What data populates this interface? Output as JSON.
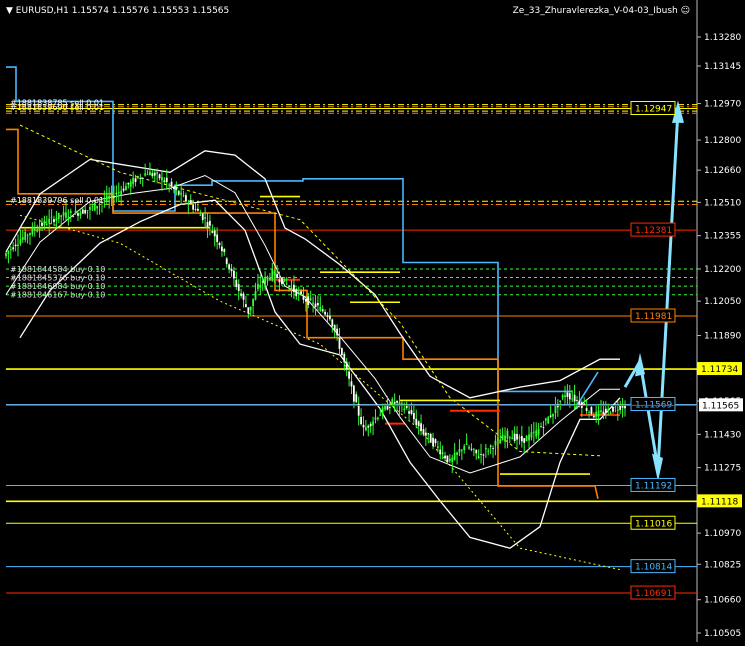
{
  "header": {
    "symbol_label": "EURUSD,H1",
    "ohlc": "1.15574 1.15576 1.15553 1.15565",
    "expert_name": "Ze_33_Zhuravlerezka_V-04-03_Ibush",
    "smiley": "☺"
  },
  "colors": {
    "background": "#000000",
    "axis_text": "#ffffff",
    "bull_candle": "#33ff33",
    "bear_candle": "#ffffff",
    "yellow": "#ffff00",
    "orange": "#ff8000",
    "red": "#ff2a00",
    "cyan": "#49b8ff",
    "light_cyan": "#7fdfff",
    "white_band": "#ffffff",
    "sky_arrow": "#87e3ff"
  },
  "chart_data": {
    "type": "candlestick",
    "ylim": [
      1.10505,
      1.13345
    ],
    "y_ticks": [
      "1.13280",
      "1.13145",
      "1.12970",
      "1.12800",
      "1.12660",
      "1.12510",
      "1.12355",
      "1.12200",
      "1.12050",
      "1.11890",
      "1.11740",
      "1.11585",
      "1.11430",
      "1.11275",
      "1.11120",
      "1.10970",
      "1.10825",
      "1.10660",
      "1.10505"
    ],
    "current_price": "1.11565",
    "price_levels": [
      {
        "price": "1.12947",
        "color": "yellow",
        "style": "solid-box"
      },
      {
        "price": "1.12381",
        "color": "red",
        "style": "line"
      },
      {
        "price": "1.11981",
        "color": "orange",
        "style": "line"
      },
      {
        "price": "1.11734",
        "color": "yellow",
        "style": "filled"
      },
      {
        "price": "1.11569",
        "color": "cyan",
        "style": "line"
      },
      {
        "price": "1.11192",
        "color": "cyan",
        "style": "line"
      },
      {
        "price": "1.11118",
        "color": "yellow",
        "style": "filled"
      },
      {
        "price": "1.11016",
        "color": "yellow",
        "style": "line"
      },
      {
        "price": "1.10814",
        "color": "cyan",
        "style": "line"
      },
      {
        "price": "1.10691",
        "color": "red",
        "style": "line"
      }
    ],
    "order_labels": [
      "#1881838785 sell 0.01",
      "#1881839690 sell 0.01",
      "#1881839796 sell 0.01",
      "#1881844584 buy 0.10",
      "#1881845376 buy 0.10",
      "#1881846084 buy 0.10",
      "#1881846167 buy 0.10"
    ],
    "close_path": [
      [
        0,
        1.1226
      ],
      [
        6,
        1.1233
      ],
      [
        12,
        1.1238
      ],
      [
        18,
        1.1242
      ],
      [
        24,
        1.1245
      ],
      [
        30,
        1.1246
      ],
      [
        36,
        1.1248
      ],
      [
        42,
        1.1252
      ],
      [
        48,
        1.1256
      ],
      [
        54,
        1.1261
      ],
      [
        60,
        1.1265
      ],
      [
        66,
        1.1262
      ],
      [
        72,
        1.1256
      ],
      [
        78,
        1.125
      ],
      [
        84,
        1.1243
      ],
      [
        90,
        1.1232
      ],
      [
        96,
        1.1215
      ],
      [
        102,
        1.12
      ],
      [
        106,
        1.1212
      ],
      [
        112,
        1.1218
      ],
      [
        118,
        1.1213
      ],
      [
        124,
        1.1207
      ],
      [
        130,
        1.1203
      ],
      [
        136,
        1.1198
      ],
      [
        140,
        1.1184
      ],
      [
        146,
        1.116
      ],
      [
        150,
        1.1145
      ],
      [
        156,
        1.1152
      ],
      [
        162,
        1.1158
      ],
      [
        168,
        1.1155
      ],
      [
        174,
        1.1145
      ],
      [
        180,
        1.1138
      ],
      [
        186,
        1.113
      ],
      [
        192,
        1.1138
      ],
      [
        198,
        1.1133
      ],
      [
        204,
        1.1138
      ],
      [
        210,
        1.1143
      ],
      [
        216,
        1.114
      ],
      [
        222,
        1.1144
      ],
      [
        228,
        1.1152
      ],
      [
        234,
        1.1162
      ],
      [
        240,
        1.1158
      ],
      [
        246,
        1.1152
      ],
      [
        252,
        1.1154
      ],
      [
        258,
        1.11565
      ]
    ]
  }
}
